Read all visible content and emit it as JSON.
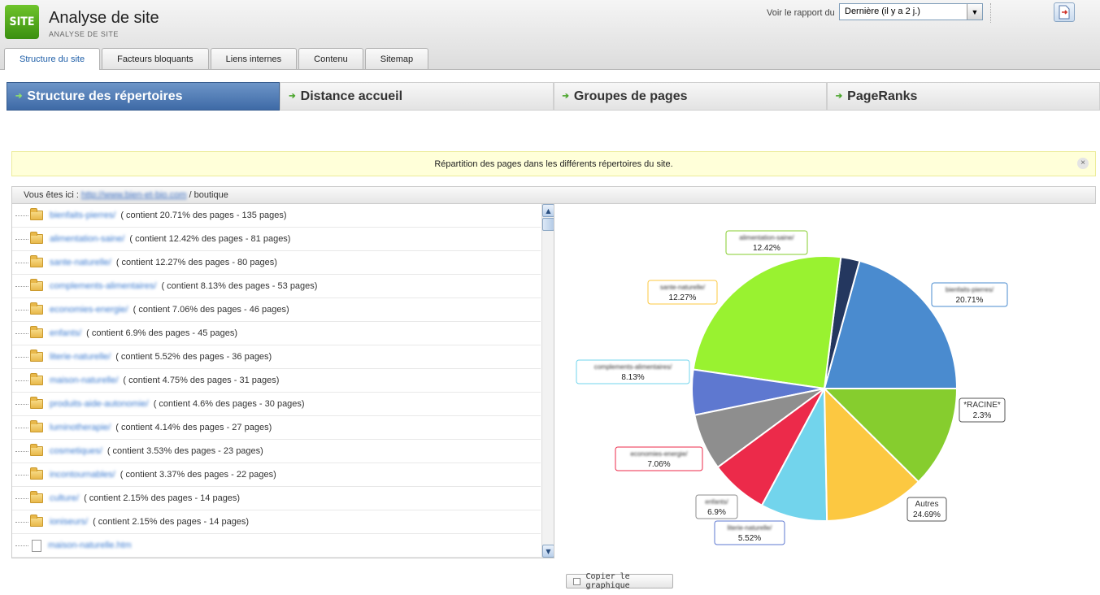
{
  "app": {
    "logo": "SITE",
    "title": "Analyse de site",
    "subtitle": "ANALYSE DE SITE"
  },
  "report": {
    "label": "Voir le rapport du",
    "selected": "Dernière (il y a 2 j.)",
    "export_icon": "export-document-icon"
  },
  "tabs": [
    {
      "label": "Structure du site",
      "active": true
    },
    {
      "label": "Facteurs bloquants"
    },
    {
      "label": "Liens internes"
    },
    {
      "label": "Contenu"
    },
    {
      "label": "Sitemap"
    }
  ],
  "subnav": [
    {
      "label": "Structure des répertoires",
      "active": true
    },
    {
      "label": "Distance accueil"
    },
    {
      "label": "Groupes de pages"
    },
    {
      "label": "PageRanks"
    }
  ],
  "info": {
    "text": "Répartition des pages dans les différents répertoires du site.",
    "close": "×"
  },
  "breadcrumb": {
    "prefix": "Vous êtes ici :",
    "link": "http://www.bien-et-bio.com",
    "current": "/ boutique"
  },
  "tree": [
    {
      "name": "bienfaits-pierres/",
      "desc": "( contient 20.71% des pages - 135 pages)",
      "type": "folder"
    },
    {
      "name": "alimentation-saine/",
      "desc": "( contient 12.42% des pages - 81 pages)",
      "type": "folder"
    },
    {
      "name": "sante-naturelle/",
      "desc": "( contient 12.27% des pages - 80 pages)",
      "type": "folder"
    },
    {
      "name": "complements-alimentaires/",
      "desc": "( contient 8.13% des pages - 53 pages)",
      "type": "folder"
    },
    {
      "name": "economies-energie/",
      "desc": "( contient 7.06% des pages - 46 pages)",
      "type": "folder"
    },
    {
      "name": "enfants/",
      "desc": "( contient 6.9% des pages - 45 pages)",
      "type": "folder"
    },
    {
      "name": "literie-naturelle/",
      "desc": "( contient 5.52% des pages - 36 pages)",
      "type": "folder"
    },
    {
      "name": "maison-naturelle/",
      "desc": "( contient 4.75% des pages - 31 pages)",
      "type": "folder"
    },
    {
      "name": "produits-aide-autonomie/",
      "desc": "( contient 4.6% des pages - 30 pages)",
      "type": "folder"
    },
    {
      "name": "luminotherapie/",
      "desc": "( contient 4.14% des pages - 27 pages)",
      "type": "folder"
    },
    {
      "name": "cosmetiques/",
      "desc": "( contient 3.53% des pages - 23 pages)",
      "type": "folder"
    },
    {
      "name": "incontournables/",
      "desc": "( contient 3.37% des pages - 22 pages)",
      "type": "folder"
    },
    {
      "name": "culture/",
      "desc": "( contient 2.15% des pages - 14 pages)",
      "type": "folder"
    },
    {
      "name": "ioniseurs/",
      "desc": "( contient 2.15% des pages - 14 pages)",
      "type": "folder"
    },
    {
      "name": "maison-naturelle.htm",
      "desc": "",
      "type": "file"
    }
  ],
  "chart_data": {
    "type": "pie",
    "slices": [
      {
        "label": "bienfaits-pierres/",
        "value": 20.71,
        "value_label": "20.71%",
        "color": "#4a8bcf"
      },
      {
        "label": "*RACINE*",
        "value": 2.3,
        "value_label": "2.3%",
        "color": "#24375f"
      },
      {
        "label": "Autres",
        "value": 24.69,
        "value_label": "24.69%",
        "color": "#99f230"
      },
      {
        "label": "literie-naturelle/",
        "value": 5.52,
        "value_label": "5.52%",
        "color": "#5e78d0"
      },
      {
        "label": "enfants/",
        "value": 6.9,
        "value_label": "6.9%",
        "color": "#8e8e8e"
      },
      {
        "label": "economies-energie/",
        "value": 7.06,
        "value_label": "7.06%",
        "color": "#ec2a4a"
      },
      {
        "label": "complements-alimentaires/",
        "value": 8.13,
        "value_label": "8.13%",
        "color": "#72d4ec"
      },
      {
        "label": "sante-naturelle/",
        "value": 12.27,
        "value_label": "12.27%",
        "color": "#fcc841"
      },
      {
        "label": "alimentation-saine/",
        "value": 12.42,
        "value_label": "12.42%",
        "color": "#86cd2e"
      }
    ],
    "blurred_labels": [
      "bienfaits-pierres/",
      "literie-naturelle/",
      "enfants/",
      "economies-energie/",
      "complements-alimentaires/",
      "sante-naturelle/",
      "alimentation-saine/"
    ]
  },
  "copy_button": {
    "label": "Copier le graphique"
  }
}
